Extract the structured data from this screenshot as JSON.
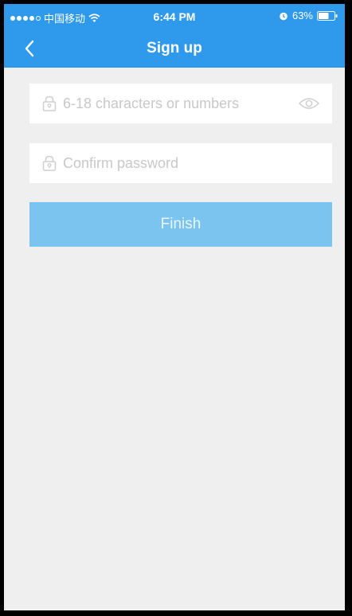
{
  "status_bar": {
    "carrier": "中国移动",
    "time": "6:44 PM",
    "battery_percent": "63%",
    "icons": [
      "signal-icon",
      "wifi-icon",
      "alarm-icon",
      "battery-icon"
    ]
  },
  "nav": {
    "title": "Sign up",
    "back_icon": "chevron-left-icon"
  },
  "form": {
    "password": {
      "value": "",
      "placeholder": "6-18 characters or numbers",
      "icon": "lock-icon",
      "toggle_icon": "eye-icon"
    },
    "confirm": {
      "value": "",
      "placeholder": "Confirm password",
      "icon": "lock-icon"
    },
    "finish_label": "Finish"
  },
  "colors": {
    "header": "#2f9aeb",
    "background": "#efefef",
    "button": "#7bc4f0",
    "placeholder": "#c8c8c8"
  }
}
